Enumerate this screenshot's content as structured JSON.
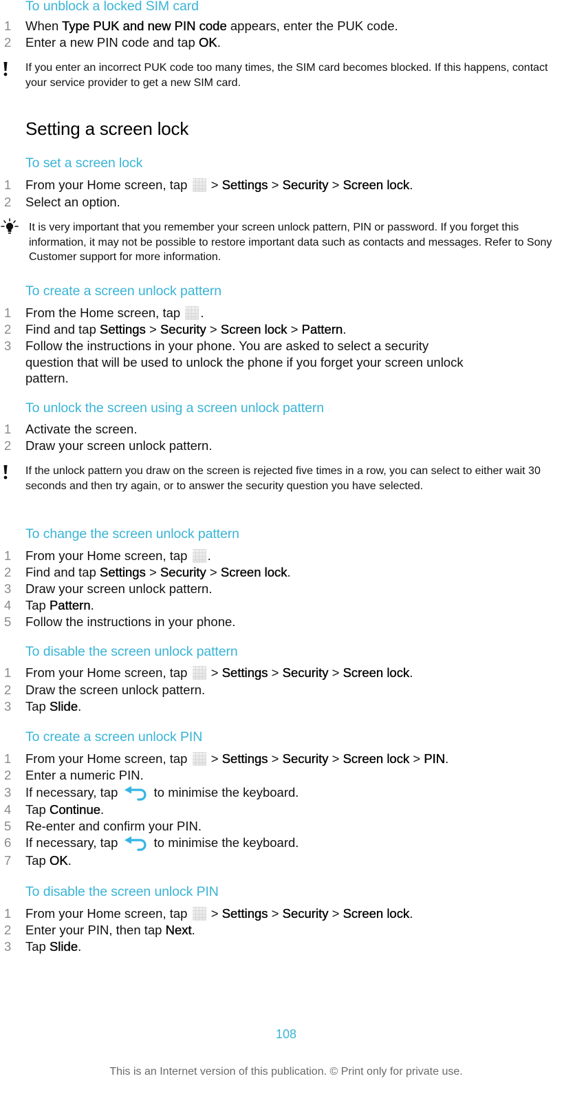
{
  "colors": {
    "heading_accent": "#3ab4d6",
    "step_number": "#8a8a8a",
    "footer_text": "#6a6a6a"
  },
  "sections": {
    "unblock_sim": {
      "title": "To unblock a locked SIM card",
      "steps": [
        {
          "num": "1",
          "parts": [
            "When ",
            "Type PUK and new PIN code",
            " appears, enter the PUK code."
          ]
        },
        {
          "num": "2",
          "parts": [
            "Enter a new PIN code and tap ",
            "OK",
            "."
          ]
        }
      ],
      "warning": {
        "icon": "exclamation-icon",
        "text": "If you enter an incorrect PUK code too many times, the SIM card becomes blocked. If this happens, contact your service provider to get a new SIM card."
      }
    },
    "setting_screen_lock": {
      "title": "Setting a screen lock"
    },
    "set_screen_lock": {
      "title": "To set a screen lock",
      "steps": [
        {
          "num": "1",
          "parts": [
            "From your Home screen, tap ",
            "[apps-grid-icon]",
            " > ",
            "Settings",
            " > ",
            "Security",
            " > ",
            "Screen lock",
            "."
          ]
        },
        {
          "num": "2",
          "parts": [
            "Select an option."
          ]
        }
      ],
      "tip": {
        "icon": "lightbulb-icon",
        "text": "It is very important that you remember your screen unlock pattern, PIN or password. If you forget this information, it may not be possible to restore important data such as contacts and messages. Refer to Sony Customer support for more information."
      }
    },
    "create_pattern": {
      "title": "To create a screen unlock pattern",
      "steps": [
        {
          "num": "1",
          "parts": [
            "From the Home screen, tap ",
            "[apps-grid-icon]",
            "."
          ]
        },
        {
          "num": "2",
          "parts": [
            "Find and tap ",
            "Settings",
            " > ",
            "Security",
            " > ",
            "Screen lock",
            " > ",
            "Pattern",
            "."
          ]
        },
        {
          "num": "3",
          "line1": "Follow the instructions in your phone. You are asked to select a security",
          "line2": "question that will be used to unlock the phone if you forget your screen unlock",
          "line3": "pattern."
        }
      ]
    },
    "unlock_with_pattern": {
      "title": "To unlock the screen using a screen unlock pattern",
      "steps": [
        {
          "num": "1",
          "text": "Activate the screen."
        },
        {
          "num": "2",
          "text": "Draw your screen unlock pattern."
        }
      ],
      "warning": {
        "icon": "exclamation-icon",
        "text": "If the unlock pattern you draw on the screen is rejected five times in a row, you can select to either wait 30 seconds and then try again, or to answer the security question you have selected."
      }
    },
    "change_pattern": {
      "title": "To change the screen unlock pattern",
      "steps": [
        {
          "num": "1",
          "parts": [
            "From your Home screen, tap ",
            "[apps-grid-icon]",
            "."
          ]
        },
        {
          "num": "2",
          "parts": [
            "Find and tap ",
            "Settings",
            " > ",
            "Security",
            " > ",
            "Screen lock",
            "."
          ]
        },
        {
          "num": "3",
          "text": "Draw your screen unlock pattern."
        },
        {
          "num": "4",
          "parts": [
            "Tap ",
            "Pattern",
            "."
          ]
        },
        {
          "num": "5",
          "text": "Follow the instructions in your phone."
        }
      ]
    },
    "disable_pattern": {
      "title": "To disable the screen unlock pattern",
      "steps": [
        {
          "num": "1",
          "parts": [
            "From your Home screen, tap ",
            "[apps-grid-icon]",
            " > ",
            "Settings",
            " > ",
            "Security",
            " > ",
            "Screen lock",
            "."
          ]
        },
        {
          "num": "2",
          "text": "Draw the screen unlock pattern."
        },
        {
          "num": "3",
          "parts": [
            "Tap ",
            "Slide",
            "."
          ]
        }
      ]
    },
    "create_pin": {
      "title": "To create a screen unlock PIN",
      "steps": [
        {
          "num": "1",
          "parts": [
            "From your Home screen, tap ",
            "[apps-grid-icon]",
            " > ",
            "Settings",
            " > ",
            "Security",
            " > ",
            "Screen lock",
            " > ",
            "PIN",
            "."
          ]
        },
        {
          "num": "2",
          "text": "Enter a numeric PIN."
        },
        {
          "num": "3",
          "parts": [
            "If necessary, tap ",
            "[back-icon]",
            " to minimise the keyboard."
          ]
        },
        {
          "num": "4",
          "parts": [
            "Tap ",
            "Continue",
            "."
          ]
        },
        {
          "num": "5",
          "text": "Re-enter and confirm your PIN."
        },
        {
          "num": "6",
          "parts": [
            "If necessary, tap ",
            "[back-icon]",
            " to minimise the keyboard."
          ]
        },
        {
          "num": "7",
          "parts": [
            "Tap ",
            "OK",
            "."
          ]
        }
      ]
    },
    "disable_pin": {
      "title": "To disable the screen unlock PIN",
      "steps": [
        {
          "num": "1",
          "parts": [
            "From your Home screen, tap ",
            "[apps-grid-icon]",
            " > ",
            "Settings",
            " > ",
            "Security",
            " > ",
            "Screen lock",
            "."
          ]
        },
        {
          "num": "2",
          "parts": [
            "Enter your PIN, then tap ",
            "Next",
            "."
          ]
        },
        {
          "num": "3",
          "parts": [
            "Tap ",
            "Slide",
            "."
          ]
        }
      ]
    }
  },
  "footer": {
    "page_number": "108",
    "notice": "This is an Internet version of this publication. © Print only for private use."
  }
}
